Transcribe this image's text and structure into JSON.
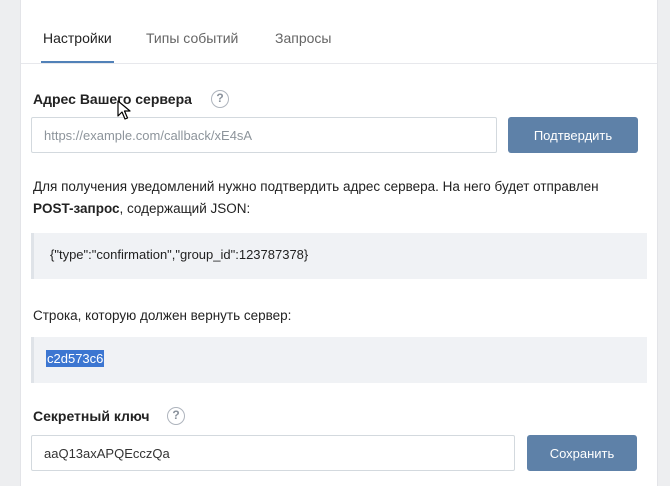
{
  "tabs": [
    {
      "label": "Настройки",
      "active": true
    },
    {
      "label": "Типы событий",
      "active": false
    },
    {
      "label": "Запросы",
      "active": false
    }
  ],
  "server": {
    "label": "Адрес Вашего сервера",
    "help": "?",
    "placeholder": "https://example.com/callback/xE4sA",
    "confirm_label": "Подтвердить"
  },
  "description": {
    "text_before": "Для получения уведомлений нужно подтвердить адрес сервера. На него будет отправлен ",
    "bold": "POST-запрос",
    "text_after": ", содержащий JSON:"
  },
  "json_box": {
    "code": "{\"type\":\"confirmation\",\"group_id\":123787378}"
  },
  "response": {
    "label": "Строка, которую должен вернуть сервер:",
    "code": "c2d573c6"
  },
  "secret": {
    "label": "Секретный ключ",
    "help": "?",
    "value": "aaQ13axAPQEcczQa",
    "save_label": "Сохранить"
  },
  "colors": {
    "accent": "#5181b8",
    "button": "#5e81a8",
    "selection": "#3c76d1"
  }
}
